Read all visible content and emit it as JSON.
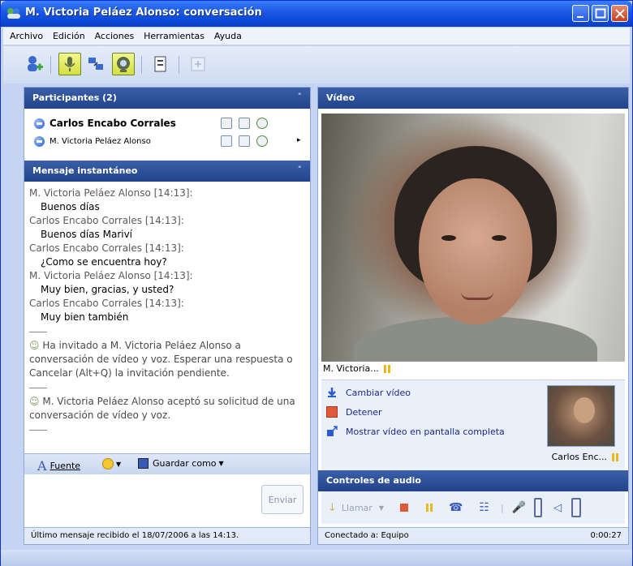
{
  "window": {
    "title": "M. Victoria Peláez Alonso: conversación"
  },
  "menu": [
    "Archivo",
    "Edición",
    "Acciones",
    "Herramientas",
    "Ayuda"
  ],
  "participants": {
    "header": "Participantes (2)",
    "list": [
      {
        "name": "Carlos Encabo Corrales"
      },
      {
        "name": "M. Victoria Peláez Alonso"
      }
    ]
  },
  "chat": {
    "header": "Mensaje instantáneo",
    "messages": [
      {
        "from": "M. Victoria Peláez Alonso [14:13]:",
        "text": "Buenos días"
      },
      {
        "from": "Carlos Encabo Corrales [14:13]:",
        "text": "Buenos días Mariví"
      },
      {
        "from": "Carlos Encabo Corrales [14:13]:",
        "text": "¿Como se encuentra hoy?"
      },
      {
        "from": "M. Victoria Peláez Alonso [14:13]:",
        "text": "Muy bien, gracias, y usted?"
      },
      {
        "from": "Carlos Encabo Corrales [14:13]:",
        "text": "Muy bien también"
      }
    ],
    "system1": "Ha invitado a M. Victoria Peláez Alonso a conversación de vídeo y voz. Esperar una respuesta o Cancelar (Alt+Q) la invitación pendiente.",
    "system2": "M. Victoria Peláez Alonso aceptó su solicitud de una conversación de vídeo y voz."
  },
  "editbar": {
    "font": "Fuente",
    "save": "Guardar como"
  },
  "send_label": "Enviar",
  "left_status": "Último mensaje recibido el 18/07/2006 a las 14:13.",
  "video": {
    "header": "Vídeo",
    "remote_label": "M. Victoria...",
    "change_video": "Cambiar vídeo",
    "stop": "Detener",
    "fullscreen": "Mostrar vídeo en pantalla completa",
    "self_label": "Carlos Enc..."
  },
  "audio": {
    "header": "Controles de audio",
    "call": "Llamar"
  },
  "right_status": {
    "connected": "Conectado a: Equipo",
    "time": "0:00:27"
  }
}
